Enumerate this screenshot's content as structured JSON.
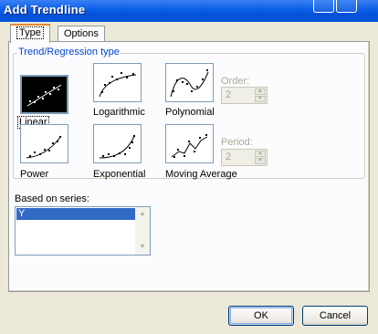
{
  "window": {
    "title": "Add Trendline"
  },
  "tabs": [
    {
      "label": "Type",
      "active": true
    },
    {
      "label": "Options",
      "active": false
    }
  ],
  "trend_group": {
    "legend": "Trend/Regression type",
    "types": [
      {
        "label": "Linear",
        "selected": true,
        "icon": "linear-trend-icon"
      },
      {
        "label": "Logarithmic",
        "selected": false,
        "icon": "logarithmic-trend-icon"
      },
      {
        "label": "Polynomial",
        "selected": false,
        "icon": "polynomial-trend-icon"
      },
      {
        "label": "Power",
        "selected": false,
        "icon": "power-trend-icon"
      },
      {
        "label": "Exponential",
        "selected": false,
        "icon": "exponential-trend-icon"
      },
      {
        "label": "Moving Average",
        "selected": false,
        "icon": "moving-average-trend-icon"
      }
    ],
    "order": {
      "label": "Order:",
      "value": "2",
      "enabled": false
    },
    "period": {
      "label": "Period:",
      "value": "2",
      "enabled": false
    }
  },
  "series": {
    "label": "Based on series:",
    "items": [
      "Y"
    ],
    "selected": "Y"
  },
  "buttons": {
    "ok": "OK",
    "cancel": "Cancel"
  },
  "colors": {
    "title_bar": "#0a5ee8",
    "dialog_bg": "#ece9d8",
    "accent": "#0046d5",
    "selection": "#316ac5"
  }
}
